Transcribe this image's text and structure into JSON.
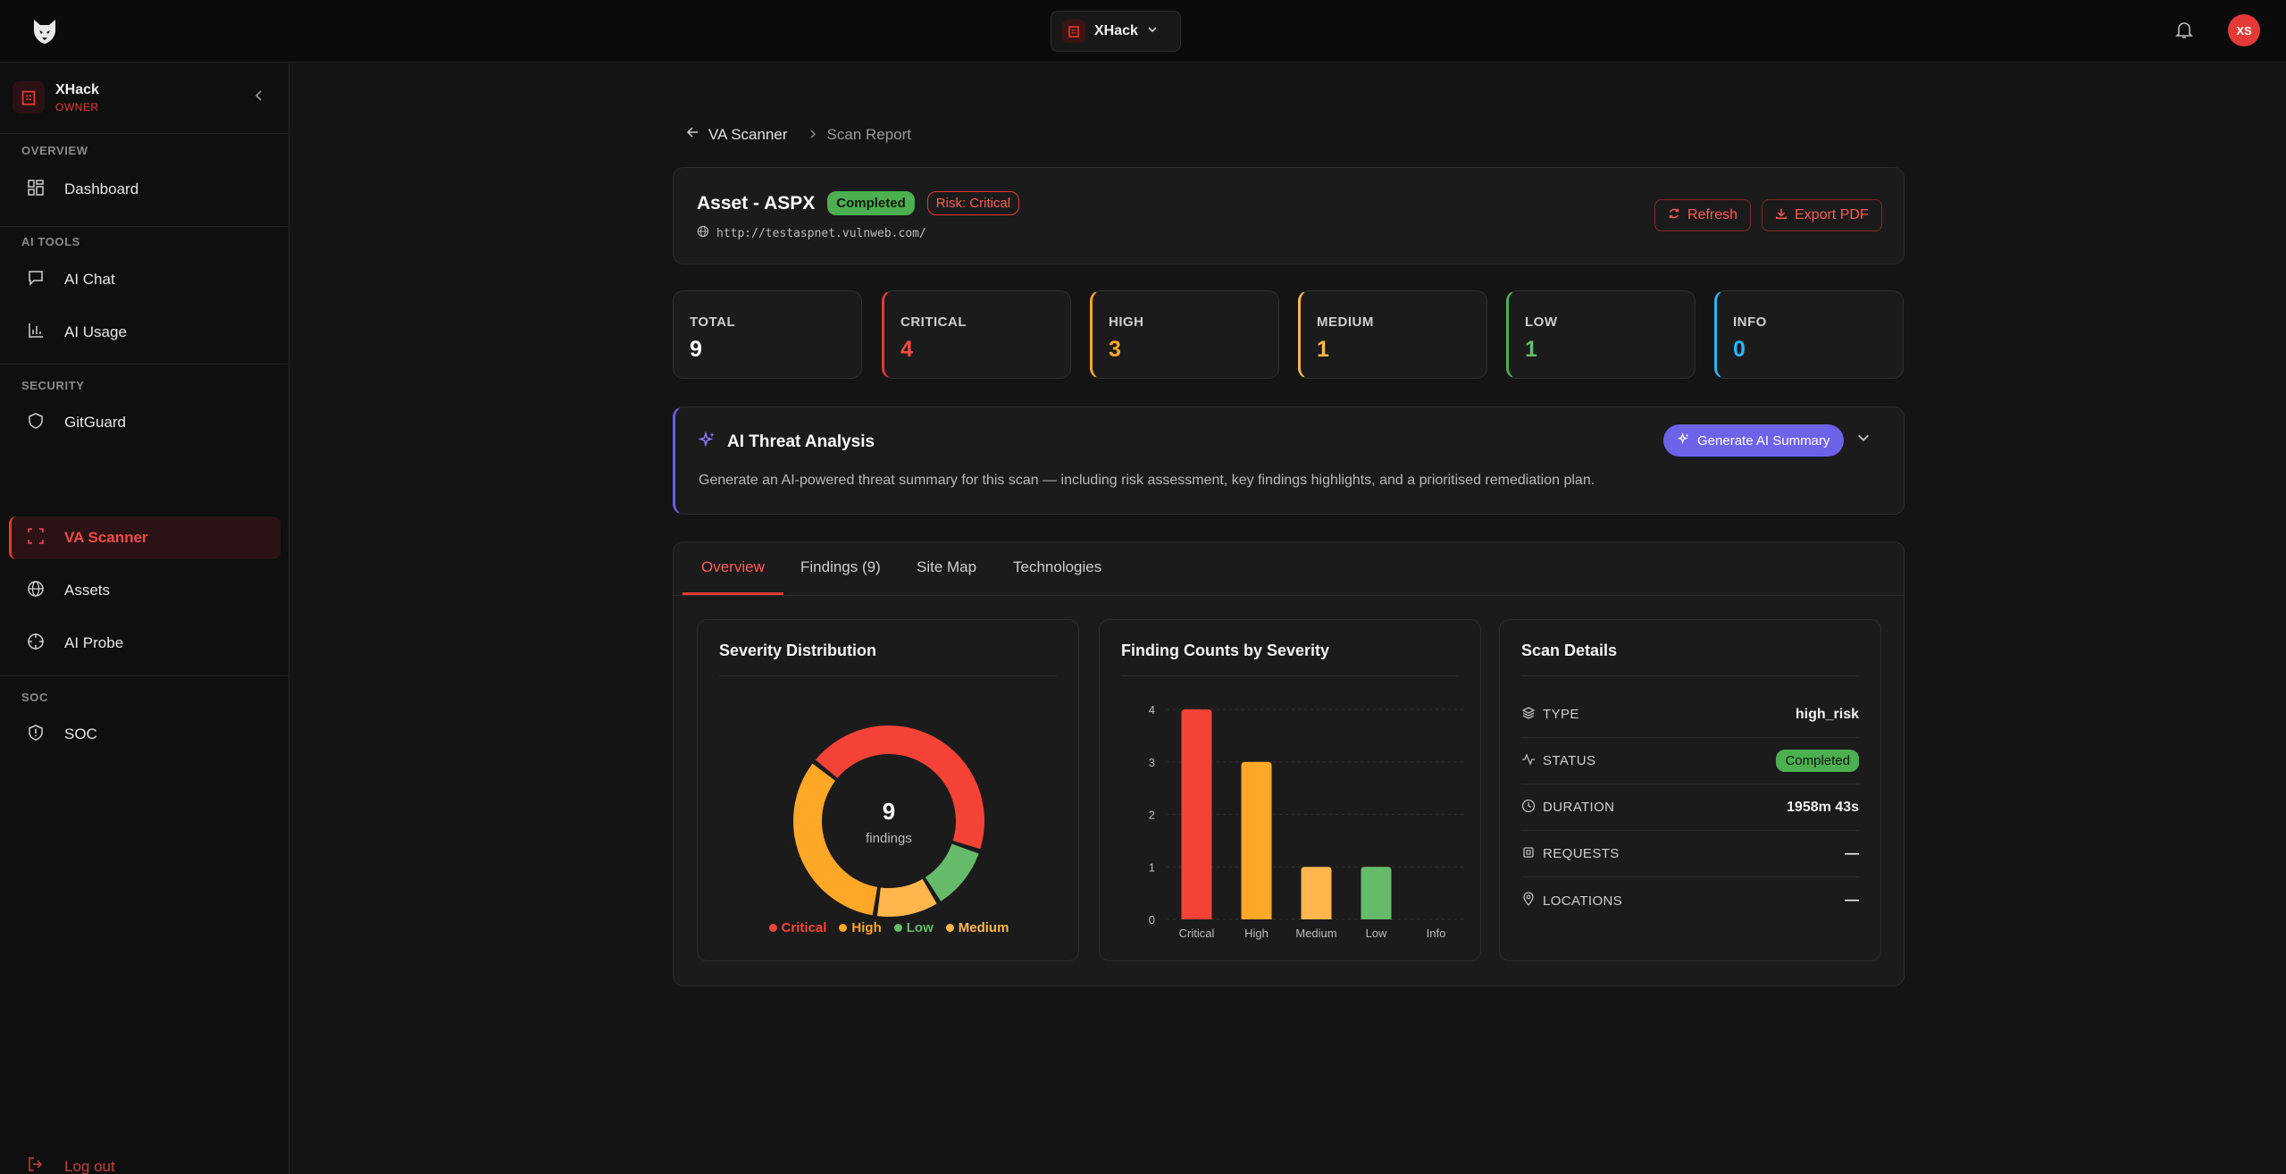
{
  "topbar": {
    "org_name": "XHack",
    "avatar_initials": "XS"
  },
  "sidebar": {
    "workspace_name": "XHack",
    "workspace_role": "OWNER",
    "sections": {
      "overview": "OVERVIEW",
      "ai_tools": "AI TOOLS",
      "security": "SECURITY",
      "soc": "SOC"
    },
    "items": {
      "dashboard": "Dashboard",
      "ai_chat": "AI Chat",
      "ai_usage": "AI Usage",
      "gitguard": "GitGuard",
      "va_scanner": "VA Scanner",
      "assets": "Assets",
      "ai_probe": "AI Probe",
      "soc": "SOC"
    },
    "logout": "Log out"
  },
  "breadcrumb": {
    "parent": "VA Scanner",
    "current": "Scan Report"
  },
  "header": {
    "title": "Asset - ASPX",
    "status": "Completed",
    "risk": "Risk: Critical",
    "url": "http://testaspnet.vulnweb.com/",
    "refresh_label": "Refresh",
    "export_label": "Export PDF"
  },
  "stats": [
    {
      "label": "TOTAL",
      "value": "9",
      "color": "#ffffff",
      "accent": "#2f2f2f"
    },
    {
      "label": "CRITICAL",
      "value": "4",
      "color": "#ff4a43",
      "accent": "#e53935"
    },
    {
      "label": "HIGH",
      "value": "3",
      "color": "#ffa726",
      "accent": "#ffa726"
    },
    {
      "label": "MEDIUM",
      "value": "1",
      "color": "#ffb74d",
      "accent": "#ffb74d"
    },
    {
      "label": "LOW",
      "value": "1",
      "color": "#66bb6a",
      "accent": "#4caf50"
    },
    {
      "label": "INFO",
      "value": "0",
      "color": "#29b6f6",
      "accent": "#29b6f6"
    }
  ],
  "ai_analysis": {
    "title": "AI Threat Analysis",
    "button": "Generate AI Summary",
    "description": "Generate an AI-powered threat summary for this scan — including risk assessment, key findings highlights, and a prioritised remediation plan."
  },
  "tabs": [
    "Overview",
    "Findings (9)",
    "Site Map",
    "Technologies"
  ],
  "severity_distribution": {
    "title": "Severity Distribution",
    "center_value": "9",
    "center_label": "findings",
    "legend": [
      {
        "label": "Critical",
        "color": "#f44336"
      },
      {
        "label": "High",
        "color": "#ffa726"
      },
      {
        "label": "Low",
        "color": "#66bb6a"
      },
      {
        "label": "Medium",
        "color": "#ffb74d"
      }
    ]
  },
  "finding_counts": {
    "title": "Finding Counts by Severity"
  },
  "chart_data": [
    {
      "type": "pie",
      "title": "Severity Distribution",
      "categories": [
        "Critical",
        "Low",
        "Medium",
        "High"
      ],
      "values": [
        4,
        1,
        1,
        3
      ],
      "colors": [
        "#f44336",
        "#66bb6a",
        "#ffb74d",
        "#ffa726"
      ]
    },
    {
      "type": "bar",
      "title": "Finding Counts by Severity",
      "categories": [
        "Critical",
        "High",
        "Medium",
        "Low",
        "Info"
      ],
      "values": [
        4,
        3,
        1,
        1,
        0
      ],
      "colors": [
        "#f44336",
        "#ffa726",
        "#ffb74d",
        "#66bb6a",
        "#29b6f6"
      ],
      "yticks": [
        "0",
        "1",
        "2",
        "3",
        "4"
      ],
      "ylim": [
        0,
        4
      ]
    }
  ],
  "scan_details": {
    "title": "Scan Details",
    "type_label": "TYPE",
    "type_value": "high_risk",
    "status_label": "STATUS",
    "status_value": "Completed",
    "duration_label": "DURATION",
    "duration_value": "1958m 43s",
    "requests_label": "REQUESTS",
    "requests_value": "—",
    "locations_label": "LOCATIONS",
    "locations_value": "—"
  }
}
